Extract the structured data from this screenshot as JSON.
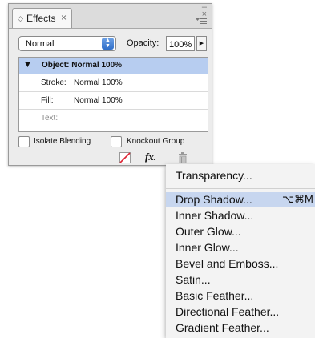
{
  "panel": {
    "tab_label": "Effects",
    "tab_close": "×",
    "win_minimize": "–",
    "win_close": "×",
    "blend_mode": "Normal",
    "opacity_label": "Opacity:",
    "opacity_value": "100%",
    "rows": [
      {
        "label": "Object: Normal 100%"
      },
      {
        "label": "Stroke:",
        "value": "Normal 100%"
      },
      {
        "label": "Fill:",
        "value": "Normal 100%"
      },
      {
        "label": "Text:"
      }
    ],
    "isolate_blending": "Isolate Blending",
    "knockout_group": "Knockout Group",
    "fx_label": "fx."
  },
  "menu": {
    "transparency": "Transparency...",
    "items": [
      {
        "label": "Drop Shadow...",
        "shortcut": "⌥⌘M",
        "highlighted": true
      },
      {
        "label": "Inner Shadow..."
      },
      {
        "label": "Outer Glow..."
      },
      {
        "label": "Inner Glow..."
      },
      {
        "label": "Bevel and Emboss..."
      },
      {
        "label": "Satin..."
      },
      {
        "label": "Basic Feather..."
      },
      {
        "label": "Directional Feather..."
      },
      {
        "label": "Gradient Feather..."
      }
    ]
  }
}
